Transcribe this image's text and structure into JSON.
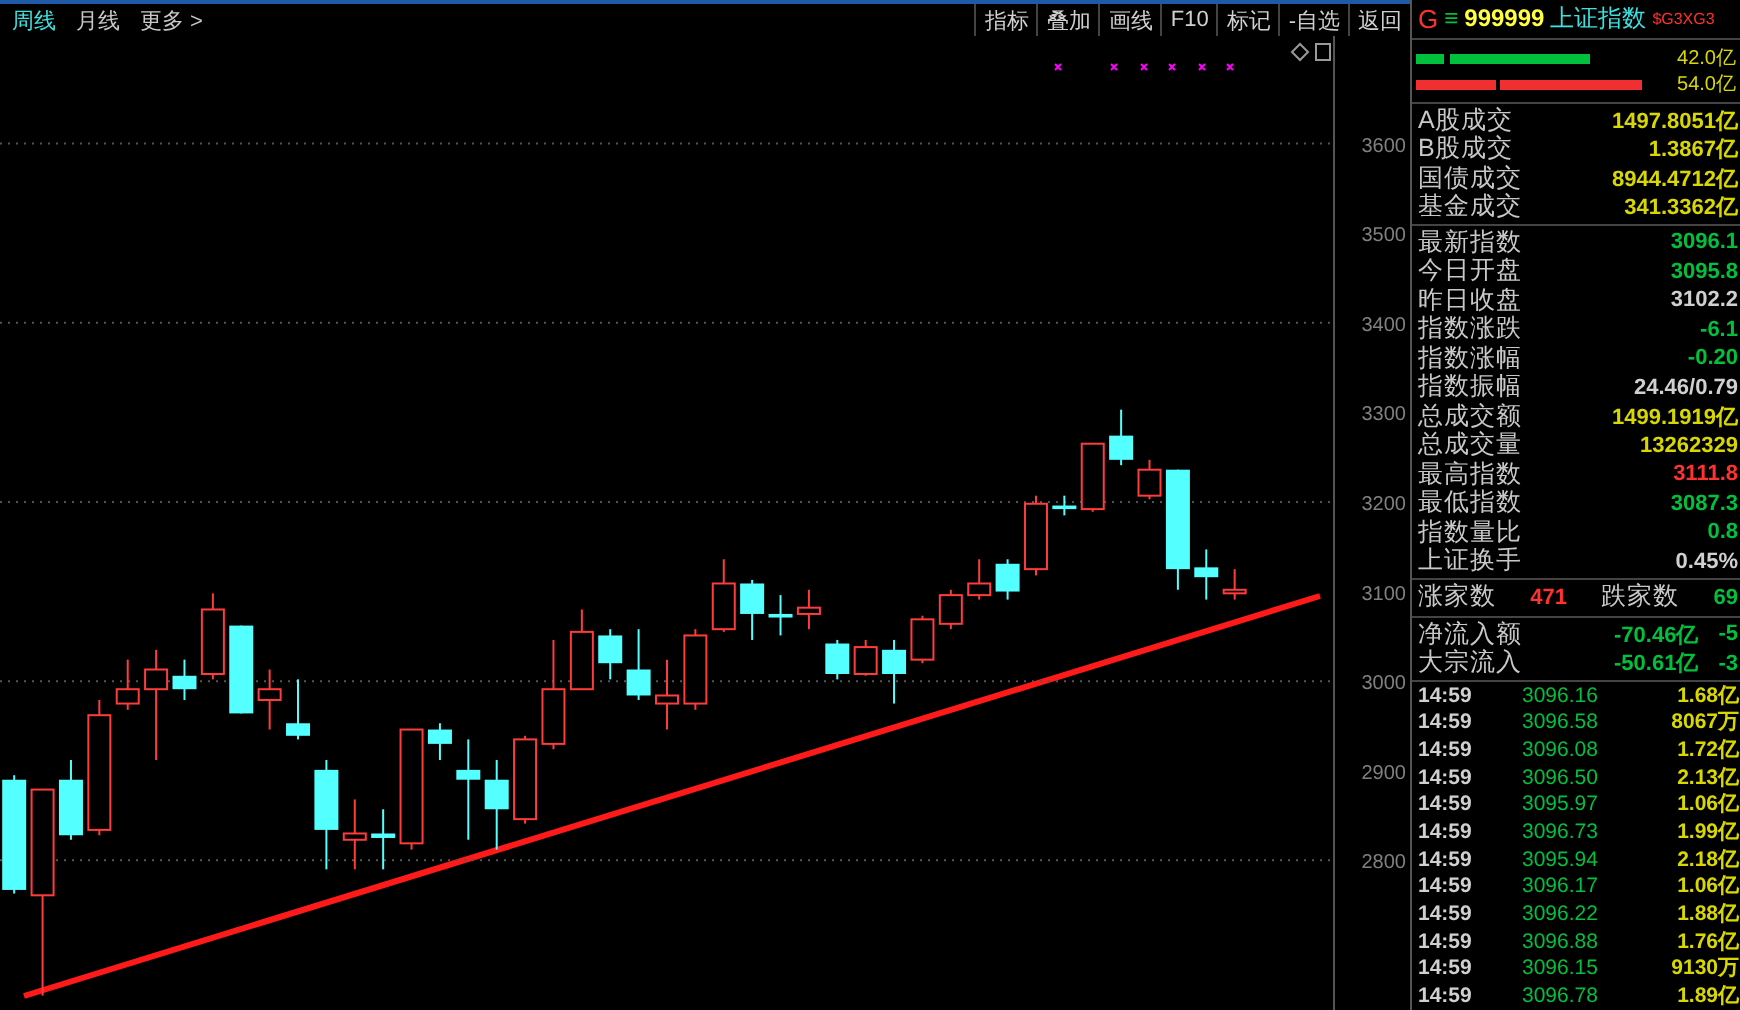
{
  "toolbar": {
    "periods": [
      {
        "label": "周线",
        "selected": true
      },
      {
        "label": "月线",
        "selected": false
      },
      {
        "label": "更多 >",
        "selected": false
      }
    ],
    "buttons": [
      "指标",
      "叠加",
      "画线",
      "F10",
      "标记",
      "-自选",
      "返回"
    ]
  },
  "chart": {
    "chart_data": {
      "type": "candlestick",
      "categories": [
        null,
        null,
        null,
        null,
        null,
        null,
        null,
        null,
        null,
        null,
        null,
        null,
        null,
        null,
        null,
        null,
        null,
        null,
        null,
        null,
        null,
        null,
        null,
        null,
        null,
        null,
        null,
        null,
        null,
        null,
        null,
        null,
        null,
        null,
        null,
        null,
        null,
        null,
        null,
        null,
        null,
        null,
        null,
        null,
        null,
        null,
        null
      ],
      "ohlc": [
        [
          2890,
          2895,
          2763,
          2767
        ],
        [
          2761,
          2879,
          2649,
          2879
        ],
        [
          2890,
          2912,
          2823,
          2828
        ],
        [
          2834,
          2979,
          2828,
          2962
        ],
        [
          2975,
          3024,
          2968,
          2991
        ],
        [
          2991,
          3035,
          2912,
          3013
        ],
        [
          3006,
          3024,
          2979,
          2991
        ],
        [
          3008,
          3098,
          3002,
          3080
        ],
        [
          3062,
          3062,
          2964,
          2964
        ],
        [
          2979,
          3013,
          2946,
          2991
        ],
        [
          2953,
          3002,
          2935,
          2939
        ],
        [
          2901,
          2912,
          2790,
          2834
        ],
        [
          2823,
          2868,
          2790,
          2830
        ],
        [
          2830,
          2857,
          2790,
          2825
        ],
        [
          2819,
          2946,
          2812,
          2946
        ],
        [
          2946,
          2953,
          2912,
          2930
        ],
        [
          2901,
          2935,
          2823,
          2890
        ],
        [
          2890,
          2912,
          2812,
          2857
        ],
        [
          2846,
          2939,
          2841,
          2935
        ],
        [
          2930,
          3046,
          2924,
          2991
        ],
        [
          2991,
          3080,
          2991,
          3055
        ],
        [
          3051,
          3058,
          3002,
          3020
        ],
        [
          3013,
          3058,
          2979,
          2984
        ],
        [
          2975,
          3024,
          2946,
          2984
        ],
        [
          2975,
          3058,
          2968,
          3051
        ],
        [
          3058,
          3136,
          3055,
          3109
        ],
        [
          3109,
          3113,
          3046,
          3075
        ],
        [
          3075,
          3096,
          3051,
          3071
        ],
        [
          3075,
          3102,
          3058,
          3082
        ],
        [
          3042,
          3046,
          3002,
          3008
        ],
        [
          3008,
          3046,
          3006,
          3038
        ],
        [
          3035,
          3046,
          2975,
          3008
        ],
        [
          3024,
          3073,
          3020,
          3069
        ],
        [
          3064,
          3102,
          3058,
          3096
        ],
        [
          3096,
          3136,
          3091,
          3109
        ],
        [
          3131,
          3136,
          3091,
          3100
        ],
        [
          3125,
          3207,
          3118,
          3198
        ],
        [
          3196,
          3207,
          3185,
          3192
        ],
        [
          3192,
          3265,
          3189,
          3265
        ],
        [
          3274,
          3303,
          3241,
          3247
        ],
        [
          3207,
          3247,
          3203,
          3236
        ],
        [
          3236,
          3236,
          3102,
          3125
        ],
        [
          3127,
          3147,
          3091,
          3116
        ],
        [
          3098,
          3125,
          3091,
          3102
        ],
        null,
        null,
        null
      ],
      "ylim": [
        2633,
        3720
      ],
      "yticks": [
        3600,
        3500,
        3400,
        3300,
        3200,
        3100,
        3000,
        2900,
        2800
      ],
      "grid": true
    }
  },
  "quote": {
    "prefix": "G",
    "menu_glyph": "≡",
    "code": "999999",
    "name": "上证指数",
    "tag": "$G3XG3"
  },
  "flow_bars": [
    {
      "kind": "buy",
      "value": "42.0亿"
    },
    {
      "kind": "sell",
      "value": "54.0亿"
    }
  ],
  "turnover": [
    {
      "label": "A股成交",
      "value": "1497.8051亿",
      "color": "#d8d800"
    },
    {
      "label": "B股成交",
      "value": "1.3867亿",
      "color": "#d8d800"
    },
    {
      "label": "国债成交",
      "value": "8944.4712亿",
      "color": "#d8d800"
    },
    {
      "label": "基金成交",
      "value": "341.3362亿",
      "color": "#d8d800"
    }
  ],
  "index_stats": [
    {
      "label": "最新指数",
      "value": "3096.1",
      "color": "#00c03c"
    },
    {
      "label": "今日开盘",
      "value": "3095.8",
      "color": "#00c03c"
    },
    {
      "label": "昨日收盘",
      "value": "3102.2",
      "color": "#d0d0d0"
    },
    {
      "label": "指数涨跌",
      "value": "-6.1",
      "color": "#00c03c"
    },
    {
      "label": "指数涨幅",
      "value": "-0.20",
      "color": "#00c03c"
    },
    {
      "label": "指数振幅",
      "value": "24.46/0.79",
      "color": "#d0d0d0"
    },
    {
      "label": "总成交额",
      "value": "1499.1919亿",
      "color": "#d8d800"
    },
    {
      "label": "总成交量",
      "value": "13262329",
      "color": "#d8d800"
    },
    {
      "label": "最高指数",
      "value": "3111.8",
      "color": "#ff3232"
    },
    {
      "label": "最低指数",
      "value": "3087.3",
      "color": "#00c03c"
    },
    {
      "label": "指数量比",
      "value": "0.8",
      "color": "#00c03c"
    },
    {
      "label": "上证换手",
      "value": "0.45%",
      "color": "#d0d0d0"
    }
  ],
  "breadth": {
    "up_label": "涨家数",
    "up_count": "471",
    "down_label": "跌家数",
    "down_count": "69"
  },
  "flows": [
    {
      "label": "净流入额",
      "value": "-70.46亿",
      "ratio": "-5"
    },
    {
      "label": "大宗流入",
      "value": "-50.61亿",
      "ratio": "-3"
    }
  ],
  "ticks": [
    {
      "time": "14:59",
      "price": "3096.16",
      "volume": "1.68亿"
    },
    {
      "time": "14:59",
      "price": "3096.58",
      "volume": "8067万"
    },
    {
      "time": "14:59",
      "price": "3096.08",
      "volume": "1.72亿"
    },
    {
      "time": "14:59",
      "price": "3096.50",
      "volume": "2.13亿"
    },
    {
      "time": "14:59",
      "price": "3095.97",
      "volume": "1.06亿"
    },
    {
      "time": "14:59",
      "price": "3096.73",
      "volume": "1.99亿"
    },
    {
      "time": "14:59",
      "price": "3095.94",
      "volume": "2.18亿"
    },
    {
      "time": "14:59",
      "price": "3096.17",
      "volume": "1.06亿"
    },
    {
      "time": "14:59",
      "price": "3096.22",
      "volume": "1.88亿"
    },
    {
      "time": "14:59",
      "price": "3096.88",
      "volume": "1.76亿"
    },
    {
      "time": "14:59",
      "price": "3096.15",
      "volume": "9130万"
    },
    {
      "time": "14:59",
      "price": "3096.78",
      "volume": "1.89亿"
    }
  ]
}
